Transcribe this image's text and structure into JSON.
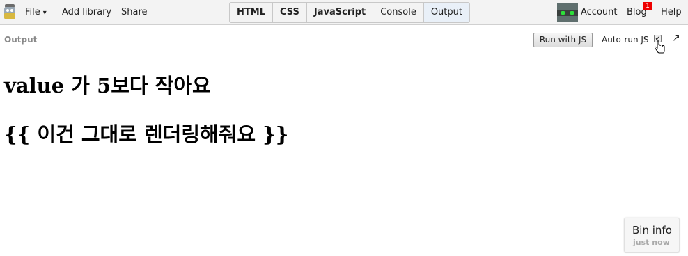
{
  "toolbar": {
    "file_label": "File",
    "file_caret": "▾",
    "add_library_label": "Add library",
    "share_label": "Share",
    "account_label": "Account",
    "blog_label": "Blog",
    "blog_badge": "1",
    "help_label": "Help"
  },
  "panels": [
    {
      "label": "HTML",
      "active": true
    },
    {
      "label": "CSS",
      "active": true
    },
    {
      "label": "JavaScript",
      "active": true
    },
    {
      "label": "Console",
      "active": false
    },
    {
      "label": "Output",
      "active": true
    }
  ],
  "output_header": {
    "label": "Output",
    "run_button_label": "Run with JS",
    "autorun_label": "Auto-run JS",
    "autorun_checked": true,
    "popout_glyph": "↗"
  },
  "content": {
    "line1": "value 가 5보다 작아요",
    "line2": "{{ 이건 그대로 렌더링해줘요 }}"
  },
  "bin_info": {
    "title": "Bin info",
    "subtitle": "just now"
  },
  "colors": {
    "toolbar_bg": "#f3f3f3",
    "badge": "#ee0000",
    "active_panel": "#e9f0f8",
    "avatar_eyes": "#2de03a"
  },
  "icons": {
    "logo": "jsbin-logo-icon",
    "avatar": "robot-avatar-icon",
    "popout": "popout-arrow-icon",
    "cursor": "hand-pointer-icon"
  }
}
